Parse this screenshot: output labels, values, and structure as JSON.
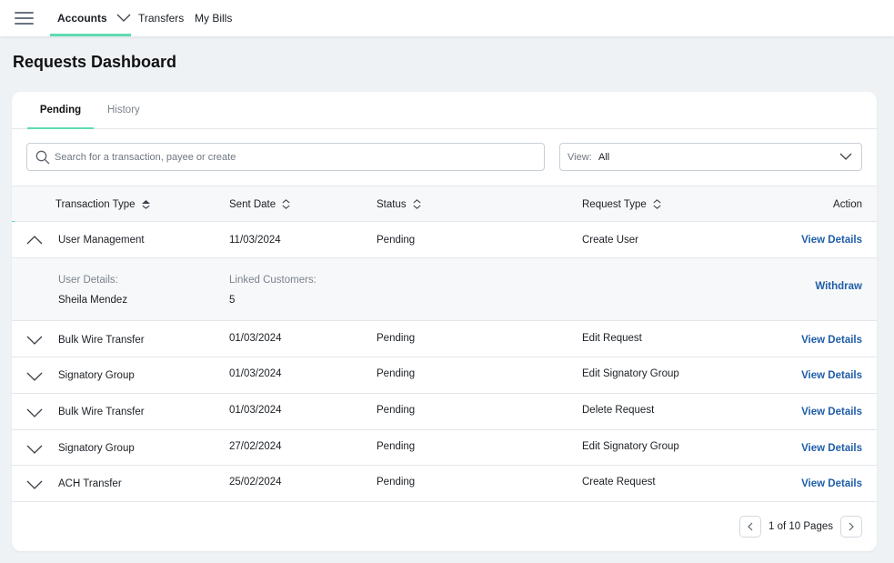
{
  "nav": {
    "items": [
      "Accounts",
      "Transfers",
      "My Bills"
    ]
  },
  "page": {
    "title": "Requests Dashboard"
  },
  "tabs": [
    "Pending",
    "History"
  ],
  "search": {
    "placeholder": "Search for a transaction, payee or create"
  },
  "view": {
    "label": "View:",
    "value": "All"
  },
  "table": {
    "headers": {
      "type": "Transaction Type",
      "date": "Sent Date",
      "status": "Status",
      "request": "Request Type",
      "action": "Action"
    },
    "action_label": "View Details",
    "rows": [
      {
        "type": "User Management",
        "date": "11/03/2024",
        "status": "Pending",
        "request": "Create User",
        "action": "View Details"
      },
      {
        "type": "Bulk Wire Transfer",
        "date": "01/03/2024",
        "status": "Pending",
        "request": "Edit Request",
        "action": "View Details"
      },
      {
        "type": "Signatory Group",
        "date": "01/03/2024",
        "status": "Pending",
        "request": "Edit Signatory Group",
        "action": "View Details"
      },
      {
        "type": "Bulk Wire Transfer",
        "date": "01/03/2024",
        "status": "Pending",
        "request": "Delete Request",
        "action": "View Details"
      },
      {
        "type": "Signatory Group",
        "date": "27/02/2024",
        "status": "Pending",
        "request": "Edit Signatory Group",
        "action": "View Details"
      },
      {
        "type": "ACH Transfer",
        "date": "25/02/2024",
        "status": "Pending",
        "request": "Create Request",
        "action": "View Details"
      }
    ],
    "expanded": {
      "user_label": "User Details:",
      "user_value": "Sheila Mendez",
      "customers_label": "Linked Customers:",
      "customers_value": "5",
      "withdraw": "Withdraw"
    }
  },
  "pagination": {
    "text": "1 of 10 Pages"
  },
  "colors": {
    "accent": "#5fdcb0",
    "link": "#1f5ea8"
  }
}
